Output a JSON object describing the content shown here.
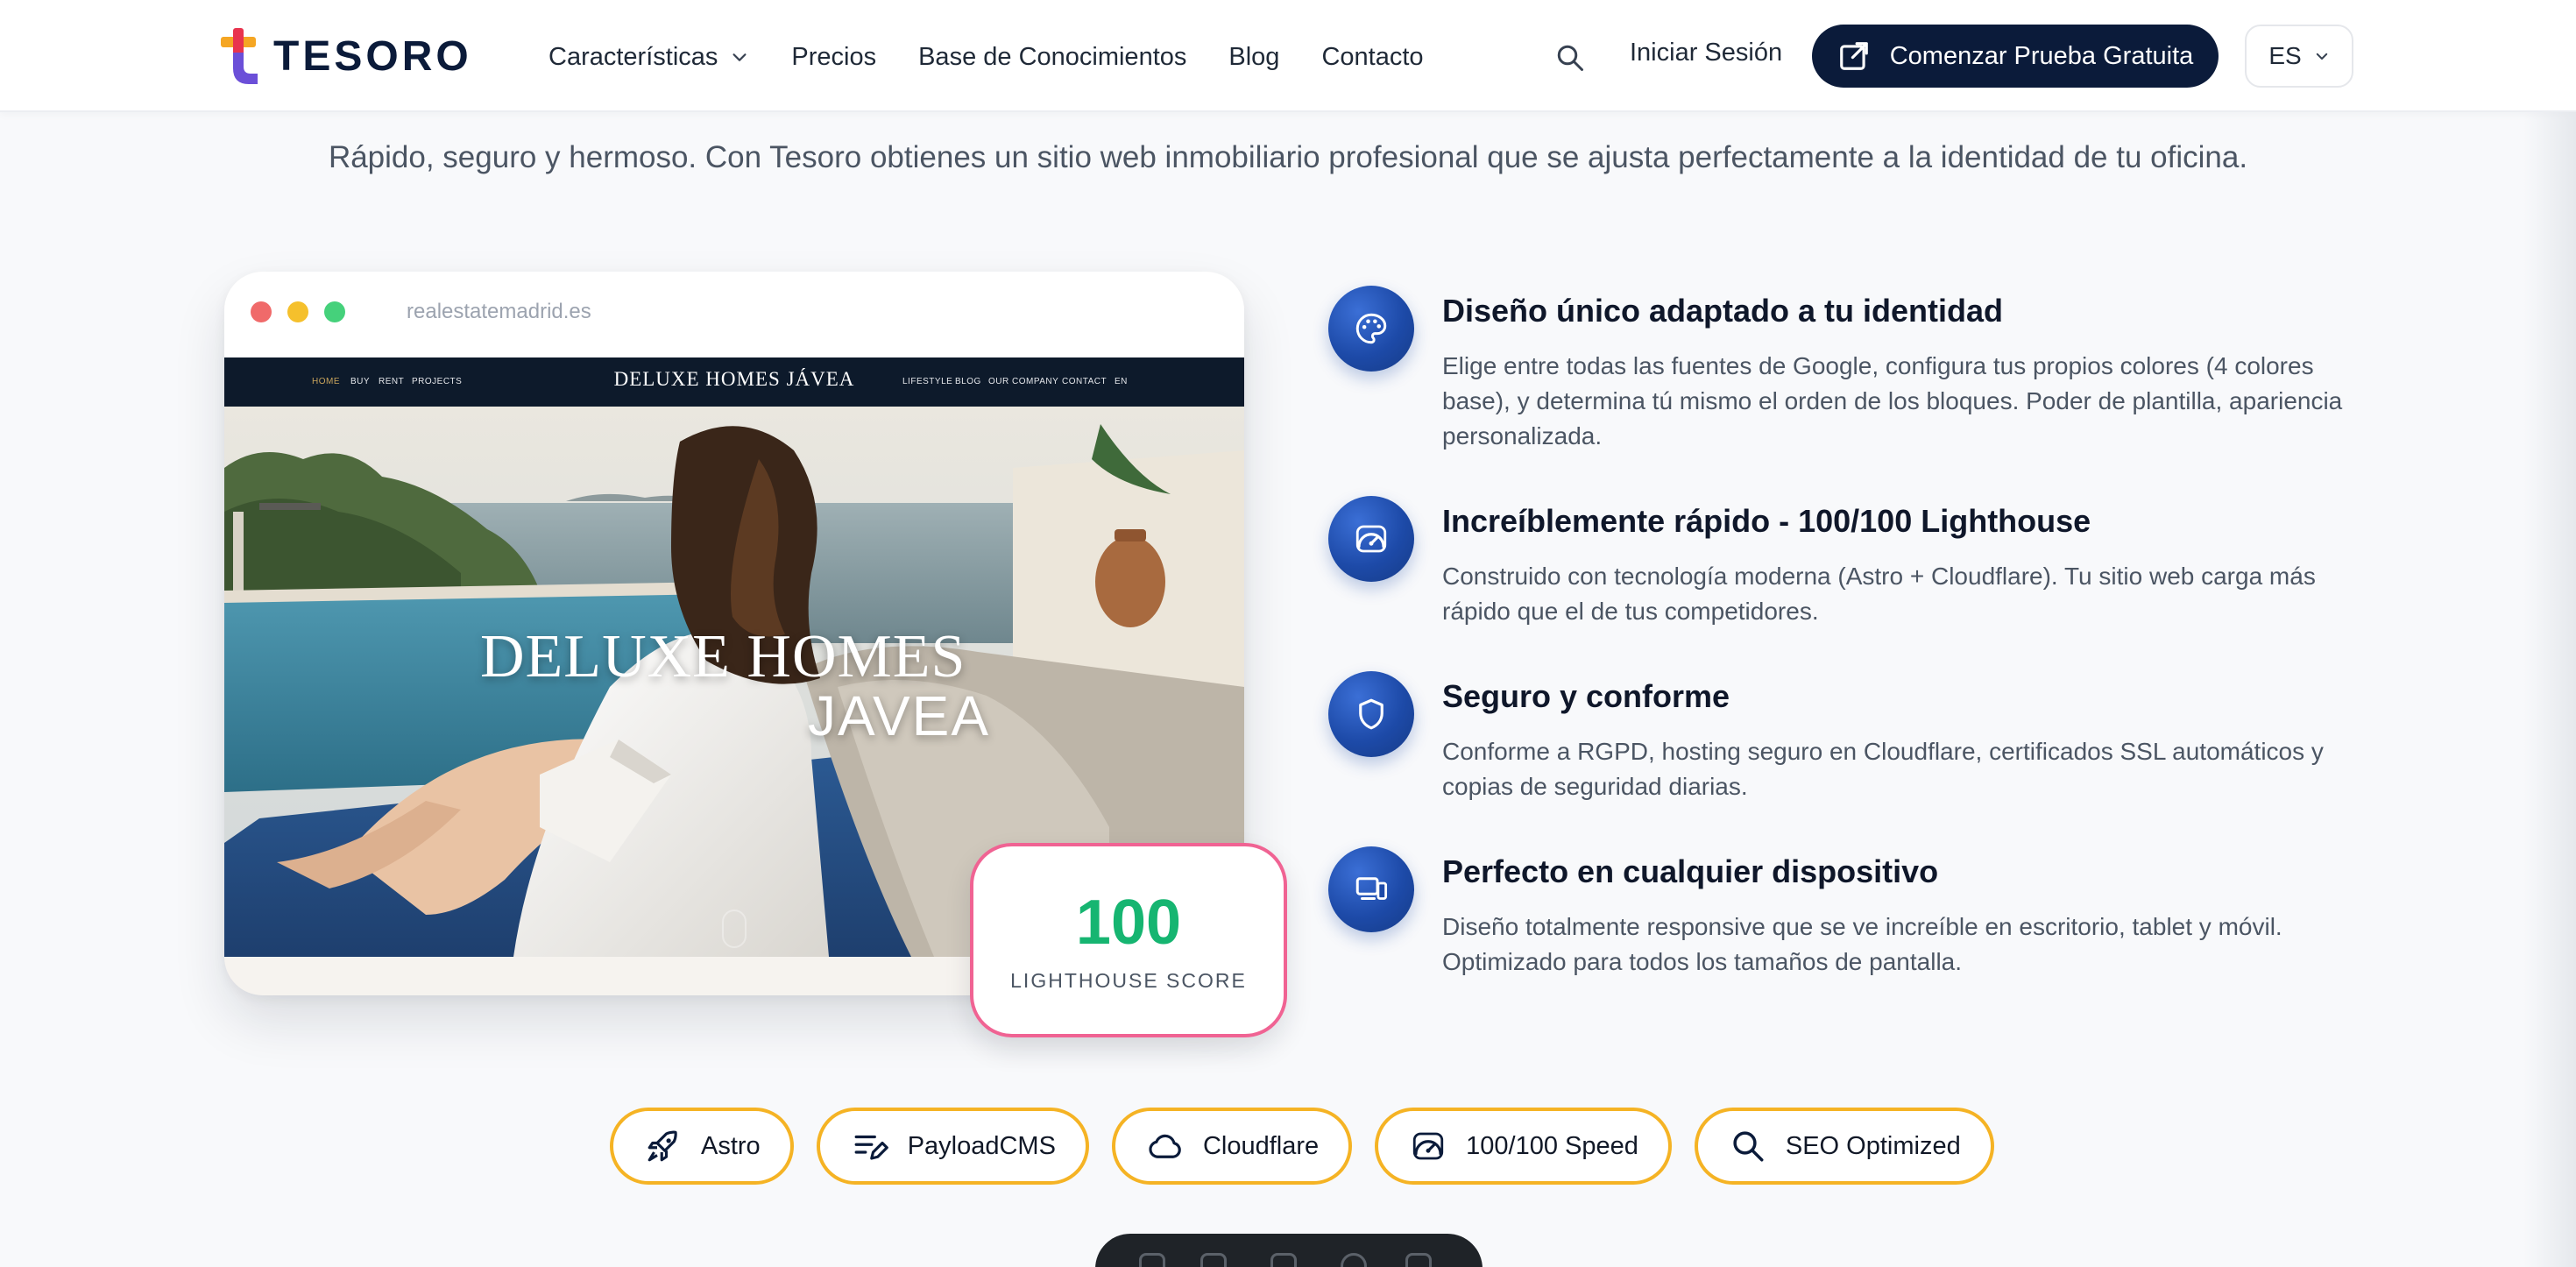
{
  "header": {
    "logo_text": "TESORO",
    "nav": [
      {
        "label": "Características",
        "has_dropdown": true
      },
      {
        "label": "Precios"
      },
      {
        "label": "Base de Conocimientos"
      },
      {
        "label": "Blog"
      },
      {
        "label": "Contacto"
      }
    ],
    "search_icon": "search-icon",
    "login_label": "Iniciar Sesión",
    "cta_label": "Comenzar Prueba Gratuita",
    "language": "ES"
  },
  "intro": "Rápido, seguro y hermoso. Con Tesoro obtienes un sitio web inmobiliario profesional que se ajusta perfectamente a la identidad de tu oficina.",
  "mockup": {
    "url": "realestatemadrid.es",
    "site_nav_left": [
      "HOME",
      "BUY",
      "RENT",
      "PROJECTS"
    ],
    "site_logo": "DELUXE HOMES JÁVEA",
    "site_nav_right": [
      "LIFESTYLE",
      "BLOG",
      "OUR COMPANY",
      "CONTACT",
      "EN"
    ],
    "hero_title": "DELUXE HOMES",
    "hero_subtitle": "JAVEA"
  },
  "score": {
    "value": "100",
    "label": "LIGHTHOUSE SCORE"
  },
  "features": [
    {
      "icon": "palette-icon",
      "title": "Diseño único adaptado a tu identidad",
      "description": "Elige entre todas las fuentes de Google, configura tus propios colores (4 colores base), y determina tú mismo el orden de los bloques. Poder de plantilla, apariencia personalizada."
    },
    {
      "icon": "speedometer-icon",
      "title": "Increíblemente rápido - 100/100 Lighthouse",
      "description": "Construido con tecnología moderna (Astro + Cloudflare). Tu sitio web carga más rápido que el de tus competidores."
    },
    {
      "icon": "shield-icon",
      "title": "Seguro y conforme",
      "description": "Conforme a RGPD, hosting seguro en Cloudflare, certificados SSL automáticos y copias de seguridad diarias."
    },
    {
      "icon": "devices-icon",
      "title": "Perfecto en cualquier dispositivo",
      "description": "Diseño totalmente responsive que se ve increíble en escritorio, tablet y móvil. Optimizado para todos los tamaños de pantalla."
    }
  ],
  "tech_pills": [
    {
      "icon": "rocket-icon",
      "label": "Astro"
    },
    {
      "icon": "edit-list-icon",
      "label": "PayloadCMS"
    },
    {
      "icon": "cloud-icon",
      "label": "Cloudflare"
    },
    {
      "icon": "speedometer-icon",
      "label": "100/100 Speed"
    },
    {
      "icon": "search-icon",
      "label": "SEO Optimized"
    }
  ],
  "colors": {
    "navy": "#0b1b3a",
    "feature_icon_blue": "#1d4aa8",
    "score_green": "#16b571",
    "score_border_pink": "#f06393",
    "pill_border_amber": "#f5b324"
  }
}
